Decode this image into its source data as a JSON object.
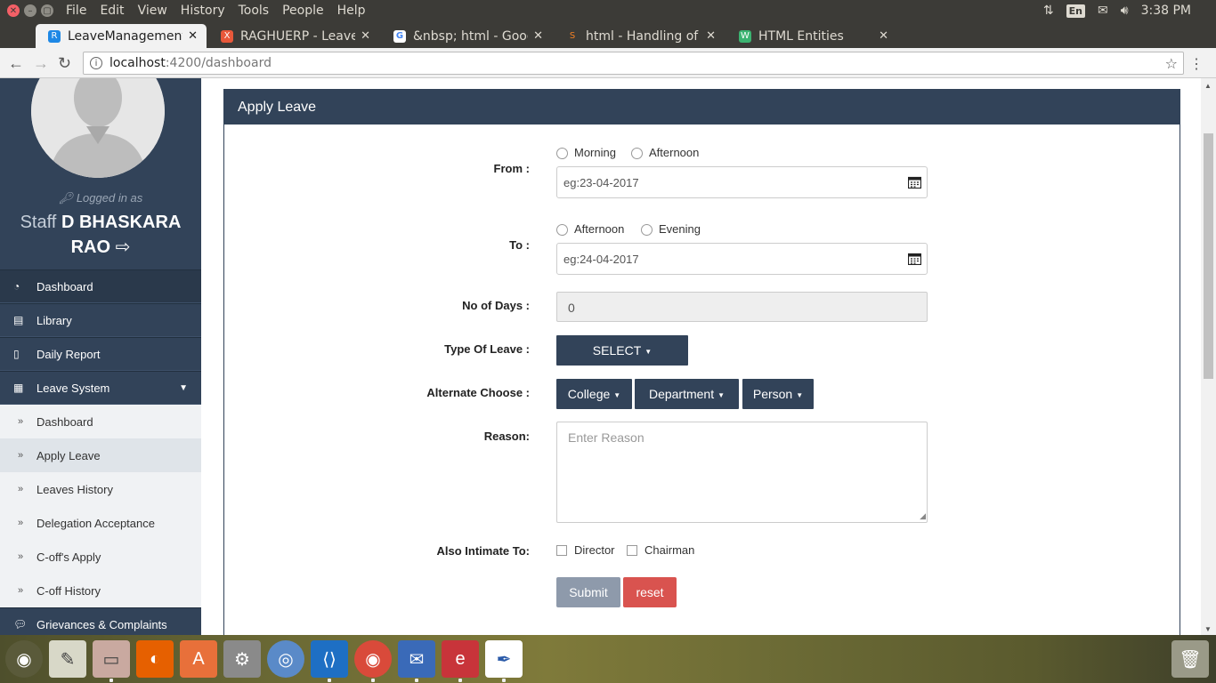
{
  "os": {
    "menu": [
      "File",
      "Edit",
      "View",
      "History",
      "Tools",
      "People",
      "Help"
    ],
    "keyboard": "En",
    "time": "3:38 PM"
  },
  "browser": {
    "tabs": [
      {
        "label": "LeaveManagement",
        "favicon_color": "#1e88e5",
        "favicon": "R"
      },
      {
        "label": "RAGHUERP - Leave",
        "favicon_color": "#e8583a",
        "favicon": "X"
      },
      {
        "label": "&nbsp; html - Goog",
        "favicon_color": "#ffffff",
        "favicon": "G"
      },
      {
        "label": "html - Handling of",
        "favicon_color": "#f48024",
        "favicon": "S"
      },
      {
        "label": "HTML Entities",
        "favicon_color": "#3cb371",
        "favicon": "W"
      }
    ],
    "url_host": "localhost",
    "url_path": ":4200/dashboard"
  },
  "sidebar": {
    "logged_in_label": "Logged in as",
    "user_prefix": "Staff",
    "user_name": "D BHASKARA RAO",
    "items": [
      {
        "label": "Dashboard",
        "icon": "dashboard-icon"
      },
      {
        "label": "Library",
        "icon": "book-icon"
      },
      {
        "label": "Daily Report",
        "icon": "file-icon"
      },
      {
        "label": "Leave System",
        "icon": "calendar-icon"
      }
    ],
    "sub_items": [
      "Dashboard",
      "Apply Leave",
      "Leaves History",
      "Delegation Acceptance",
      "C-off's Apply",
      "C-off History"
    ],
    "active_sub_item": "Apply Leave",
    "bottom_item": "Grievances & Complaints"
  },
  "form": {
    "title": "Apply Leave",
    "from_label": "From :",
    "from_options": [
      "Morning",
      "Afternoon"
    ],
    "from_placeholder": "eg:23-04-2017",
    "to_label": "To :",
    "to_options": [
      "Afternoon",
      "Evening"
    ],
    "to_placeholder": "eg:24-04-2017",
    "days_label": "No of Days :",
    "days_value": "0",
    "type_label": "Type Of Leave :",
    "type_select": "SELECT",
    "alternate_label": "Alternate Choose :",
    "alternate_buttons": [
      "College",
      "Department",
      "Person"
    ],
    "reason_label": "Reason:",
    "reason_placeholder": "Enter Reason",
    "intimate_label": "Also Intimate To:",
    "intimate_options": [
      "Director",
      "Chairman"
    ],
    "submit_label": "Submit",
    "reset_label": "reset"
  },
  "colors": {
    "primary": "#324359",
    "danger": "#d9534f",
    "submit_disabled": "#8e9aab"
  }
}
